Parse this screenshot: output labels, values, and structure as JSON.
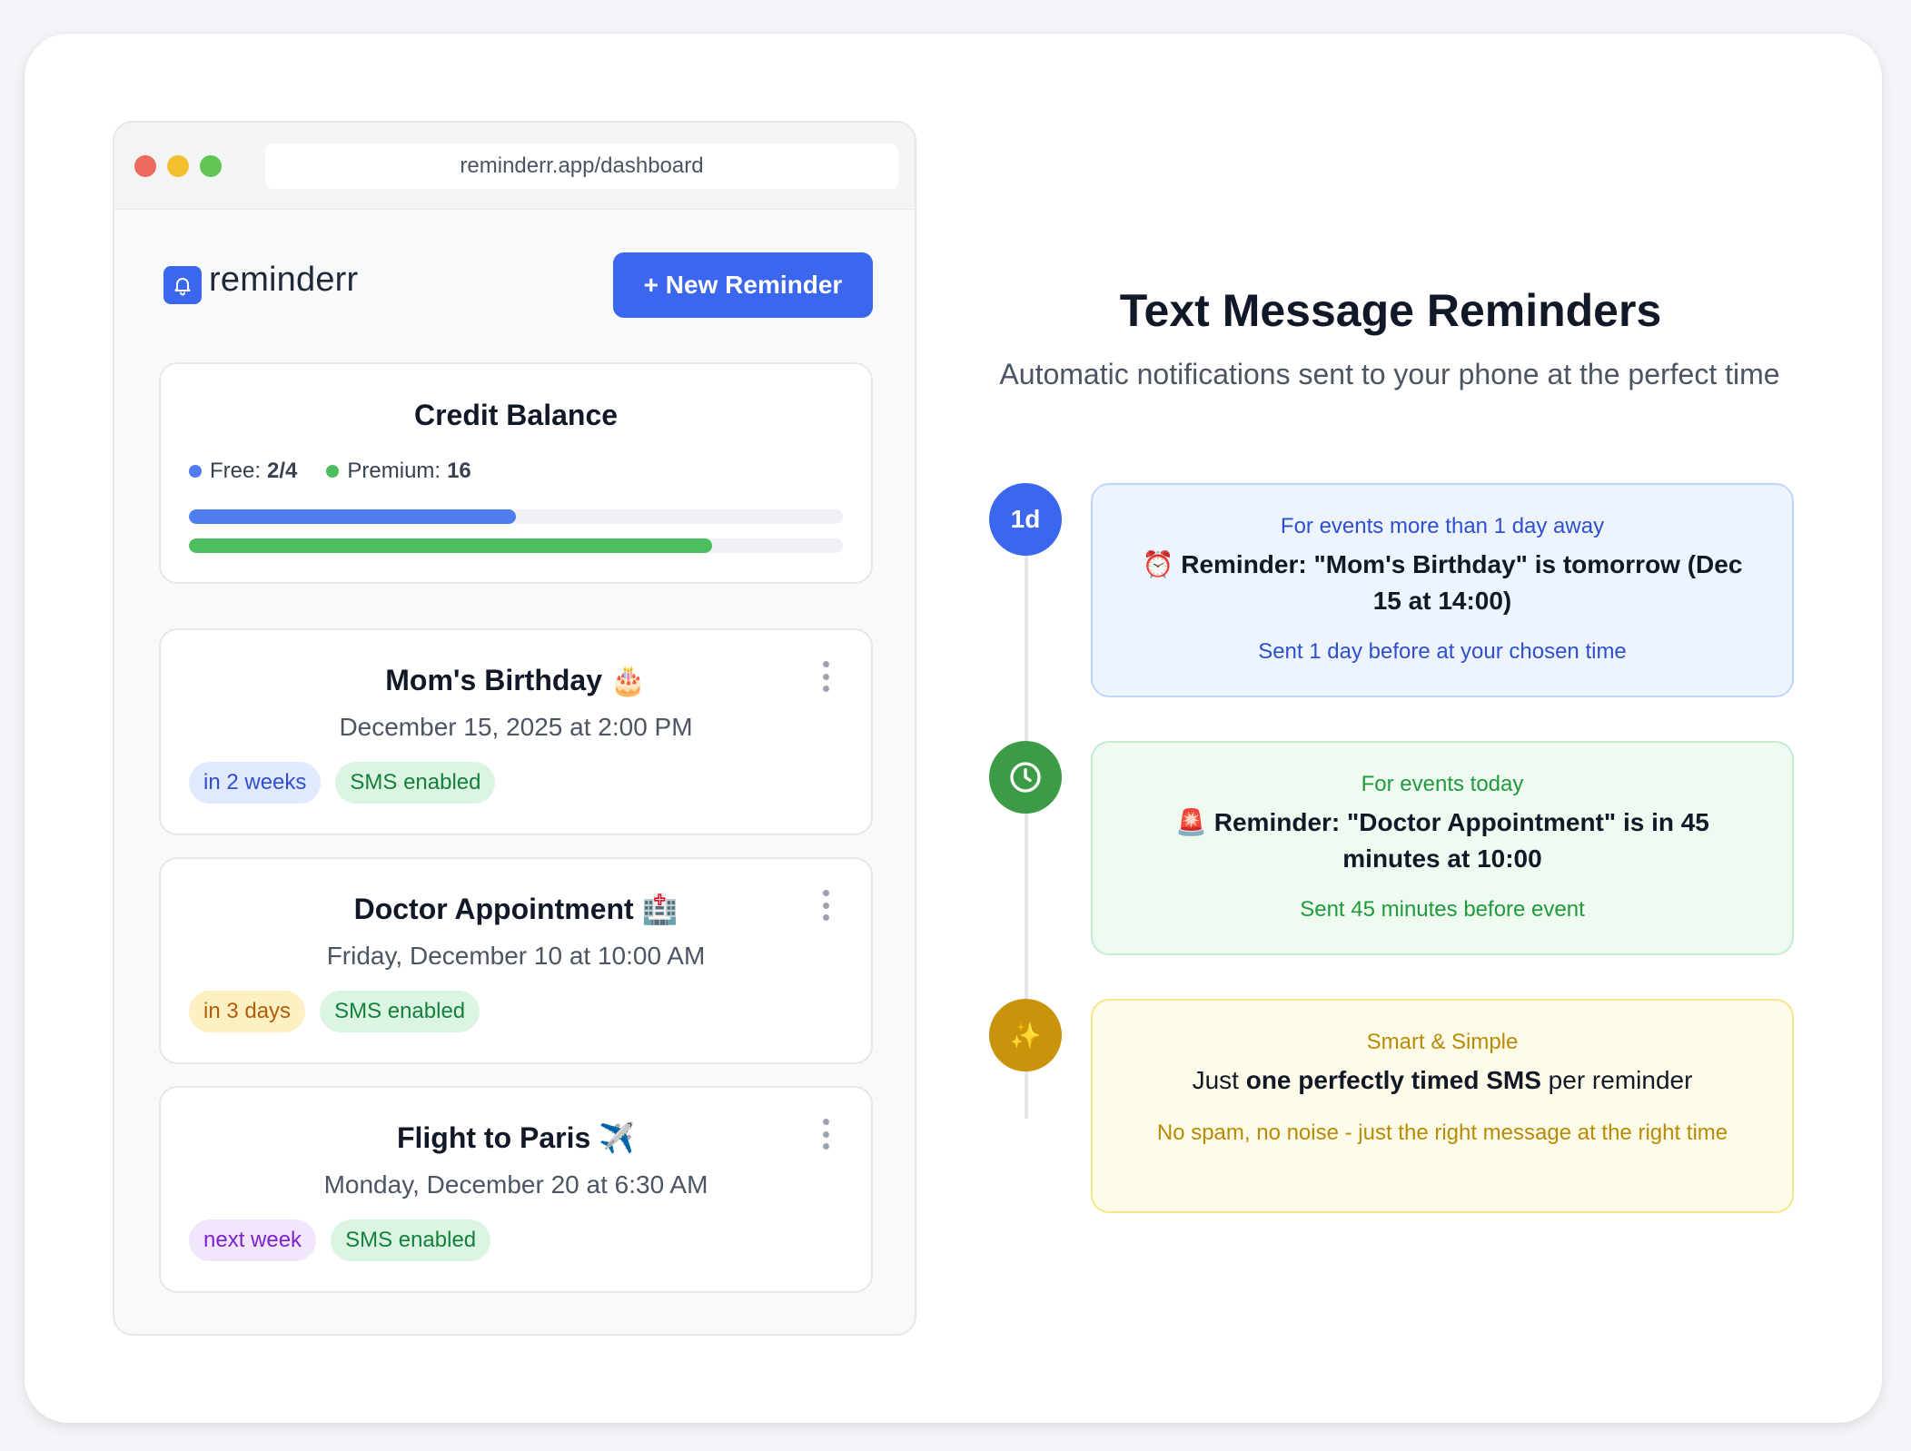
{
  "browser": {
    "url": "reminderr.app/dashboard"
  },
  "app": {
    "name": "reminderr",
    "new_button": "+ New Reminder"
  },
  "credit": {
    "title": "Credit Balance",
    "free_label": "Free:",
    "free_value": "2/4",
    "premium_label": "Premium:",
    "premium_value": "16",
    "free_fraction": 0.5,
    "premium_fraction": 0.8,
    "free_color": "#4f7df0",
    "premium_color": "#4cbe5f"
  },
  "reminders": [
    {
      "title": "Mom's Birthday",
      "emoji": "🎂",
      "date": "December 15, 2025 at 2:00 PM",
      "when": "in 2 weeks",
      "sms": "SMS enabled"
    },
    {
      "title": "Doctor Appointment",
      "emoji": "🏥",
      "date": "Friday, December 10 at 10:00 AM",
      "when": "in 3 days",
      "sms": "SMS enabled"
    },
    {
      "title": "Flight to Paris",
      "emoji": "✈️",
      "date": "Monday, December 20 at 6:30 AM",
      "when": "next week",
      "sms": "SMS enabled"
    }
  ],
  "hero": {
    "title": "Text Message Reminders",
    "subtitle": "Automatic notifications sent to your phone at the perfect time"
  },
  "timeline": [
    {
      "badge": "1d",
      "label": "For events more than 1 day away",
      "emoji": "⏰",
      "message": "Reminder: \"Mom's Birthday\" is tomorrow (Dec 15 at 14:00)",
      "footer": "Sent 1 day before at your chosen time"
    },
    {
      "icon": "clock-icon",
      "label": "For events today",
      "emoji": "🚨",
      "message": "Reminder: \"Doctor Appointment\" is in 45 minutes at 10:00",
      "footer": "Sent 45 minutes before event"
    },
    {
      "icon": "sparkles-icon",
      "badge": "✨",
      "label": "Smart & Simple",
      "message_pre": "Just ",
      "message_bold": "one perfectly timed SMS",
      "message_post": " per reminder",
      "footer": "No spam, no noise - just the right message at the right time"
    }
  ],
  "colors": {
    "accent": "#3b66ee",
    "blue_box_bg": "#eef4fe",
    "blue_box_border": "#bfd6f8",
    "blue_text": "#2e4fd0",
    "green_box_bg": "#effbf1",
    "green_box_border": "#c5ecd0",
    "green_text": "#1f9a3d",
    "green_circle": "#3b9b46",
    "yellow_box_bg": "#fefce8",
    "yellow_box_border": "#f6e58b",
    "yellow_text": "#b88a06",
    "yellow_circle": "#c9930b"
  }
}
